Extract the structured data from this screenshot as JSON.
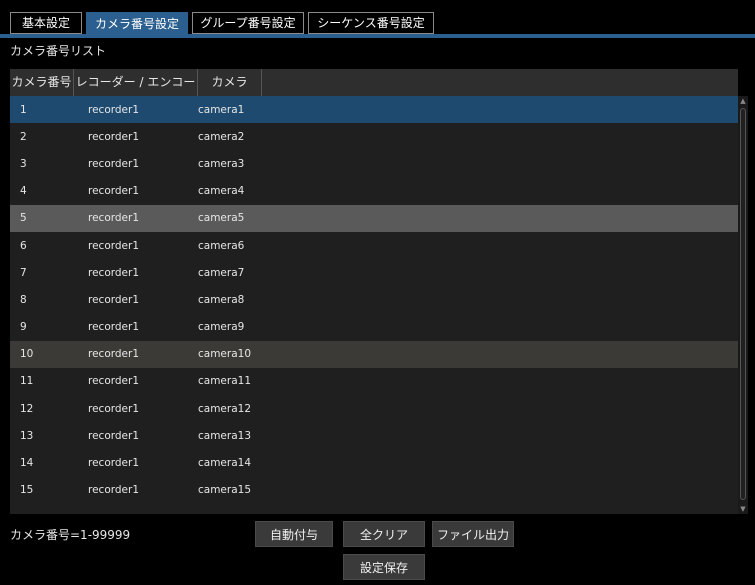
{
  "tabs": [
    {
      "label": "基本設定",
      "active": false
    },
    {
      "label": "カメラ番号設定",
      "active": true
    },
    {
      "label": "グループ番号設定",
      "active": false
    },
    {
      "label": "シーケンス番号設定",
      "active": false
    }
  ],
  "list": {
    "title": "カメラ番号リスト",
    "columns": [
      "カメラ番号",
      "レコーダー / エンコーダー",
      "カメラ"
    ],
    "rows": [
      {
        "no": "1",
        "recorder": "recorder1",
        "camera": "camera1",
        "state": "selected"
      },
      {
        "no": "2",
        "recorder": "recorder1",
        "camera": "camera2",
        "state": "normal"
      },
      {
        "no": "3",
        "recorder": "recorder1",
        "camera": "camera3",
        "state": "normal"
      },
      {
        "no": "4",
        "recorder": "recorder1",
        "camera": "camera4",
        "state": "normal"
      },
      {
        "no": "5",
        "recorder": "recorder1",
        "camera": "camera5",
        "state": "grey"
      },
      {
        "no": "6",
        "recorder": "recorder1",
        "camera": "camera6",
        "state": "normal"
      },
      {
        "no": "7",
        "recorder": "recorder1",
        "camera": "camera7",
        "state": "normal"
      },
      {
        "no": "8",
        "recorder": "recorder1",
        "camera": "camera8",
        "state": "normal"
      },
      {
        "no": "9",
        "recorder": "recorder1",
        "camera": "camera9",
        "state": "normal"
      },
      {
        "no": "10",
        "recorder": "recorder1",
        "camera": "camera10",
        "state": "dark"
      },
      {
        "no": "11",
        "recorder": "recorder1",
        "camera": "camera11",
        "state": "normal"
      },
      {
        "no": "12",
        "recorder": "recorder1",
        "camera": "camera12",
        "state": "normal"
      },
      {
        "no": "13",
        "recorder": "recorder1",
        "camera": "camera13",
        "state": "normal"
      },
      {
        "no": "14",
        "recorder": "recorder1",
        "camera": "camera14",
        "state": "normal"
      },
      {
        "no": "15",
        "recorder": "recorder1",
        "camera": "camera15",
        "state": "normal"
      }
    ]
  },
  "footer": {
    "range_label": "カメラ番号=1-99999",
    "auto_assign_label": "自動付与",
    "clear_all_label": "全クリア",
    "export_label": "ファイル出力",
    "save_label": "設定保存"
  },
  "colors": {
    "accent": "#2b5f8f",
    "selected_row": "#1d4a6e",
    "highlight_row": "#5a5a5a",
    "background": "#000000"
  },
  "icons": {
    "scroll_up": "triangle-up-icon",
    "scroll_down": "triangle-down-icon"
  }
}
